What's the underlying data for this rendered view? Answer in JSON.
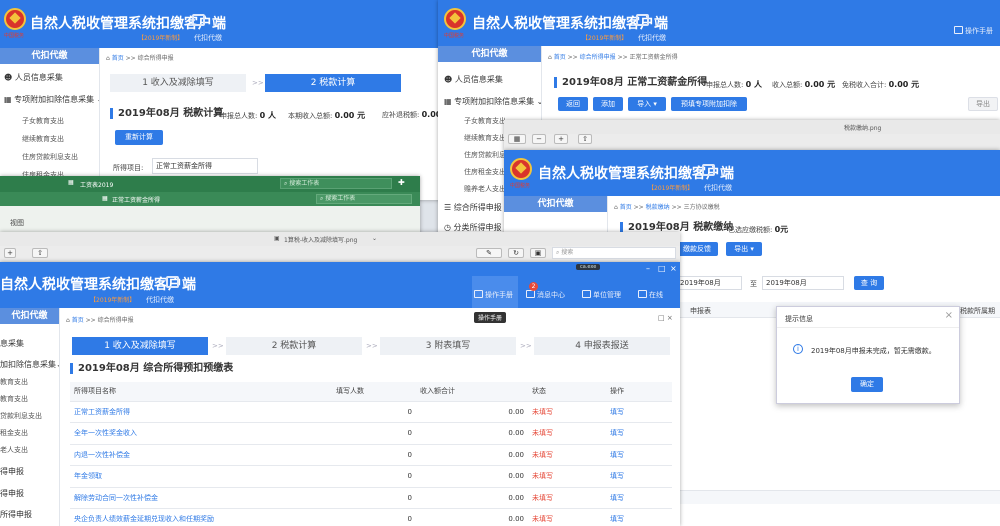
{
  "app": {
    "title": "自然人税收管理系统扣缴客户端",
    "edition": "【2019年新制】",
    "subtitle": "代扣代缴",
    "emblem_caption": "中国税务",
    "sidebar_title": "代扣代缴"
  },
  "w1": {
    "sidebar": [
      "人员信息采集",
      "专项附加扣除信息采集",
      "子女教育支出",
      "继续教育支出",
      "住房贷款利息支出",
      "住房租金支出"
    ],
    "breadcrumb": {
      "home": "首页",
      "sep": ">>",
      "page": "综合所得申报"
    },
    "steps": [
      "1 收入及减除填写",
      "2 税款计算"
    ],
    "section": "2019年08月  税款计算",
    "m1_label": "申报总人数:",
    "m1_value": "0 人",
    "m2_label": "本期收入总额:",
    "m2_value": "0.00 元",
    "m3_label": "应补退税额:",
    "m3_value": "0.00",
    "recalc": "重新计算",
    "item_label": "所得项目:",
    "item_value": "正常工资薪金所得"
  },
  "excel": {
    "title": "工资表2019",
    "sheet": "正常工资薪金所得",
    "search": "搜索工作表",
    "search2": "搜索工作表",
    "ribbon": "视图"
  },
  "w2": {
    "help": "操作手册",
    "sidebar": [
      "人员信息采集",
      "专项附加扣除信息采集",
      "子女教育支出",
      "继续教育支出",
      "住房贷款利息",
      "住房租金支出",
      "赡养老人支出",
      "综合所得申报",
      "分类所得申报"
    ],
    "breadcrumb": {
      "home": "首页",
      "sep": ">>",
      "page1": "综合所得申报",
      "page2": "正常工资薪金所得"
    },
    "section": "2019年08月  正常工资薪金所得",
    "m1_label": "申报总人数:",
    "m1_value": "0 人",
    "m2_label": "收入总额:",
    "m2_value": "0.00 元",
    "m3_label": "免税收入合计:",
    "m3_value": "0.00 元",
    "buttons": [
      "返回",
      "添加",
      "导入",
      "预填专项附加扣除"
    ],
    "export": "导出"
  },
  "viewer1": {
    "filename": "税款缴纳.png"
  },
  "w3": {
    "breadcrumb": {
      "home": "首页",
      "sep": ">>",
      "page1": "税款缴纳",
      "page2": "三方协议缴税"
    },
    "section": "2019年08月  税款缴纳",
    "selected_label": "已选应缴税额:",
    "selected_value": "0元",
    "btn_feedback": "缴款反馈",
    "btn_export": "导出",
    "period_from": "2019年08月",
    "period_to_label": "至",
    "period_to": "2019年08月",
    "query": "查 询",
    "table_head": [
      "申报表",
      "税款所属期"
    ],
    "dialog": {
      "title": "提示信息",
      "message": "2019年08月申报未完成，暂无需缴款。",
      "ok": "确定"
    }
  },
  "viewer2": {
    "filename": "1算税-收入及减除填写.png",
    "search": "搜索",
    "window_badge": "ca.exe"
  },
  "w4": {
    "toolbar": {
      "help": "操作手册",
      "messages": "消息中心",
      "units": "单位管理",
      "online": "在线",
      "badge": "2"
    },
    "tooltip": "操作手册",
    "sidebar": [
      "息采集",
      "加扣除信息采集",
      "教育支出",
      "教育支出",
      "贷款利息支出",
      "租金支出",
      "老人支出",
      "得申报",
      "得申报",
      "所得申报"
    ],
    "breadcrumb": {
      "home": "首页",
      "sep": ">>",
      "page": "综合所得申报"
    },
    "steps": [
      "1 收入及减除填写",
      "2 税款计算",
      "3 附表填写",
      "4 申报表报送"
    ],
    "section": "2019年08月  综合所得预扣预缴表",
    "columns": [
      "所得项目名称",
      "填写人数",
      "收入额合计",
      "状态",
      "操作"
    ],
    "rows": [
      [
        "正常工资薪金所得",
        "0",
        "0.00",
        "未填写",
        "填写"
      ],
      [
        "全年一次性奖金收入",
        "0",
        "0.00",
        "未填写",
        "填写"
      ],
      [
        "内退一次性补偿金",
        "0",
        "0.00",
        "未填写",
        "填写"
      ],
      [
        "年金领取",
        "0",
        "0.00",
        "未填写",
        "填写"
      ],
      [
        "解除劳动合同一次性补偿金",
        "0",
        "0.00",
        "未填写",
        "填写"
      ],
      [
        "央企负责人绩效薪金延期兑现收入和任期奖励",
        "0",
        "0.00",
        "未填写",
        "填写"
      ]
    ]
  },
  "colors": {
    "brand": "#2f7ae6",
    "sidebar_head": "#5b8fdf",
    "warning": "#e64a3a",
    "excel": "#2e7d4b"
  }
}
